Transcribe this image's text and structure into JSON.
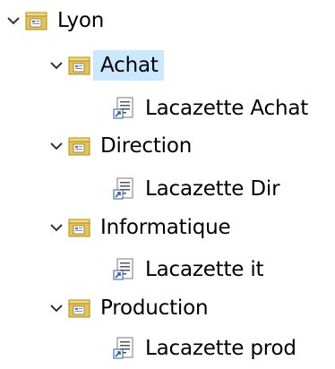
{
  "tree": {
    "root": {
      "label": "Lyon",
      "icon": "ou-folder-icon",
      "expanded": true
    },
    "children": [
      {
        "label": "Achat",
        "icon": "ou-folder-icon",
        "expanded": true,
        "selected": true,
        "child": {
          "label": "Lacazette Achat",
          "icon": "gpo-shortcut-icon"
        }
      },
      {
        "label": "Direction",
        "icon": "ou-folder-icon",
        "expanded": true,
        "selected": false,
        "child": {
          "label": "Lacazette Dir",
          "icon": "gpo-shortcut-icon"
        }
      },
      {
        "label": "Informatique",
        "icon": "ou-folder-icon",
        "expanded": true,
        "selected": false,
        "child": {
          "label": "Lacazette it",
          "icon": "gpo-shortcut-icon"
        }
      },
      {
        "label": "Production",
        "icon": "ou-folder-icon",
        "expanded": true,
        "selected": false,
        "child": {
          "label": "Lacazette prod",
          "icon": "gpo-shortcut-icon"
        }
      }
    ]
  },
  "colors": {
    "selection": "#cce8ff",
    "folder": "#e8c44a",
    "chevron": "#333333"
  }
}
